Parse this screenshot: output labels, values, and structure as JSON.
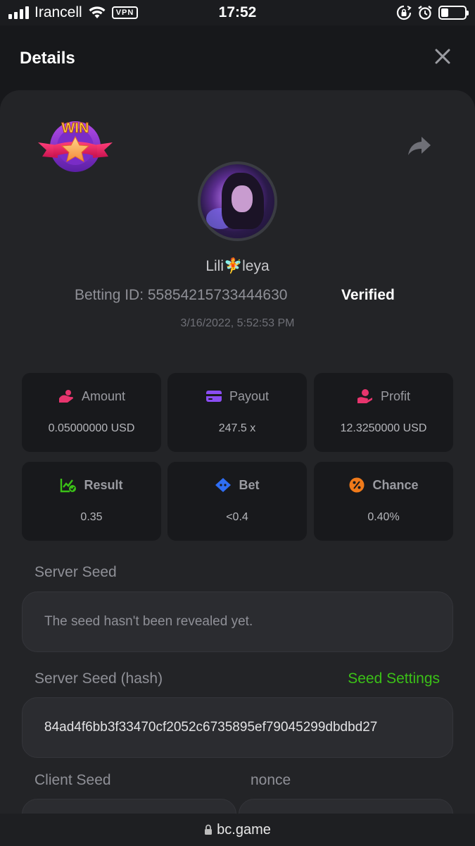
{
  "status_bar": {
    "carrier": "Irancell",
    "vpn": "VPN",
    "time": "17:52",
    "icons": [
      "signal-icon",
      "wifi-icon",
      "vpn-icon",
      "rotation-lock-icon",
      "alarm-icon",
      "battery-icon"
    ],
    "battery_level": 0.3
  },
  "header": {
    "title": "Details",
    "close_icon": "close-icon"
  },
  "bet": {
    "badge": "WIN",
    "username": "Lili🧚leya",
    "betting_id_label": "Betting ID: 55854215733444630",
    "verified": "Verified",
    "datetime": "3/16/2022, 5:52:53 PM"
  },
  "stats": [
    {
      "label": "Amount",
      "value": "0.05000000 USD",
      "icon": "amount-icon",
      "color": "#e8356e"
    },
    {
      "label": "Payout",
      "value": "247.5 x",
      "icon": "wallet-icon",
      "color": "#8a4df2"
    },
    {
      "label": "Profit",
      "value": "12.3250000 USD",
      "icon": "profit-icon",
      "color": "#e8356e"
    },
    {
      "label": "Result",
      "value": "0.35",
      "icon": "result-chart-icon",
      "color": "#3bc117"
    },
    {
      "label": "Bet",
      "value": "<0.4",
      "icon": "bet-ticket-icon",
      "color": "#2f6ef5"
    },
    {
      "label": "Chance",
      "value": "0.40%",
      "icon": "percent-icon",
      "color": "#f07a1a"
    }
  ],
  "server_seed": {
    "label": "Server Seed",
    "value": "The seed hasn't been revealed yet."
  },
  "server_seed_hash": {
    "label": "Server Seed (hash)",
    "settings_link": "Seed Settings",
    "value": "84ad4f6bb3f33470cf2052c6735895ef79045299dbdbd27"
  },
  "client_seed": {
    "label": "Client Seed",
    "nonce_label": "nonce"
  },
  "browser": {
    "url": "bc.game"
  },
  "colors": {
    "accent_green": "#3bc117",
    "background": "#17181b",
    "card": "#232427"
  }
}
